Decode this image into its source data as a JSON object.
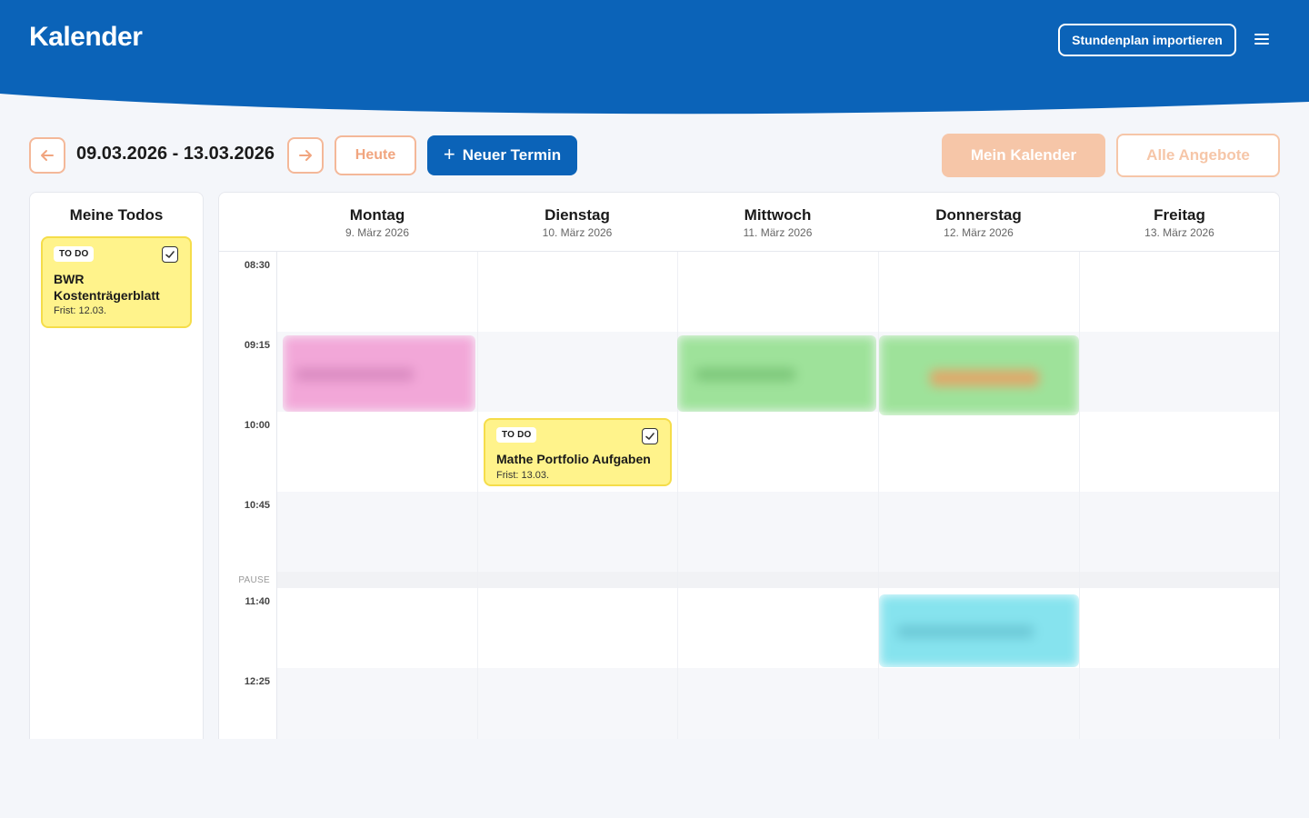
{
  "app": {
    "title": "Kalender",
    "import_label": "Stundenplan importieren",
    "menu_icon": "hamburger-menu-icon",
    "brand_color": "#0b63b8",
    "accent_color": "#f4b899"
  },
  "toolbar": {
    "prev_icon": "arrow-left-icon",
    "next_icon": "arrow-right-icon",
    "date_range": "09.03.2026 - 13.03.2026",
    "today_label": "Heute",
    "new_event_label": "Neuer Termin",
    "my_calendar_label": "Mein Kalender",
    "all_offers_label": "Alle Angebote"
  },
  "todos": {
    "title": "Meine Todos",
    "items": [
      {
        "badge": "TO DO",
        "title": "BWR Kostenträgerblatt",
        "due": "Frist: 12.03.",
        "checked": true
      }
    ]
  },
  "calendar": {
    "days": [
      {
        "name": "Montag",
        "date": "9. März 2026"
      },
      {
        "name": "Dienstag",
        "date": "10. März 2026"
      },
      {
        "name": "Mittwoch",
        "date": "11. März 2026"
      },
      {
        "name": "Donnerstag",
        "date": "12. März 2026"
      },
      {
        "name": "Freitag",
        "date": "13. März 2026"
      }
    ],
    "times": [
      "08:30",
      "09:15",
      "10:00",
      "10:45",
      "11:40",
      "12:25"
    ],
    "pause_label": "PAUSE",
    "todo_event": {
      "badge": "TO DO",
      "title": "Mathe Portfolio Aufgaben",
      "due": "Frist: 13.03.",
      "day": "Dienstag"
    },
    "events": [
      {
        "day": "Montag",
        "slot": "09:15",
        "color": "#f2a7d8",
        "blurred": true
      },
      {
        "day": "Mittwoch",
        "slot": "09:15",
        "color": "#9ee29a",
        "blurred": true
      },
      {
        "day": "Donnerstag",
        "slot": "09:15",
        "color": "#9ee29a",
        "blurred": true
      },
      {
        "day": "Donnerstag",
        "slot": "11:40",
        "color": "#86e3ee",
        "blurred": true
      }
    ]
  }
}
